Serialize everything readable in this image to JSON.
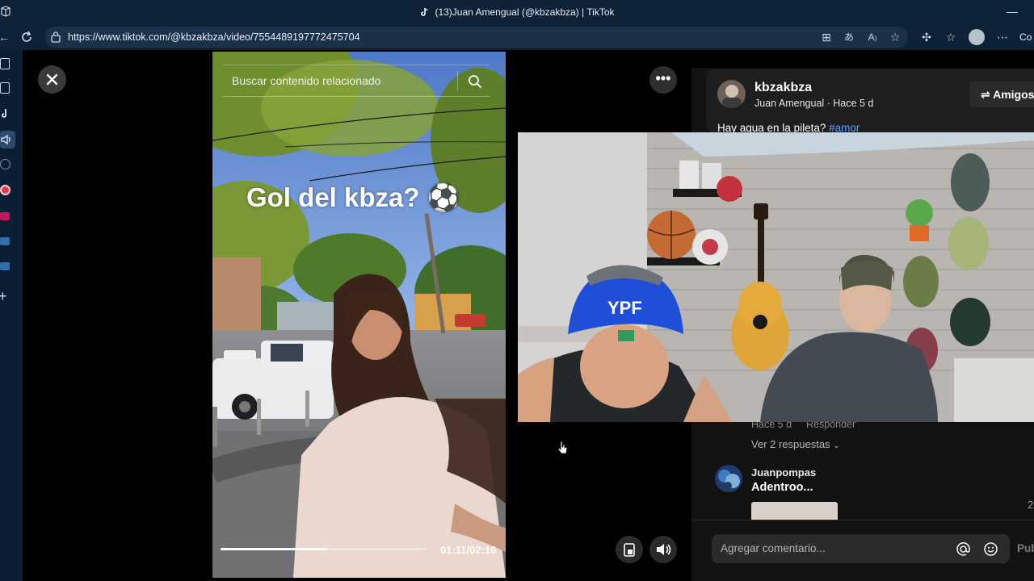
{
  "browser": {
    "tab_title": "(13)Juan Amengual (@kbzakbza) | TikTok",
    "url": "https://www.tiktok.com/@kbzakbza/video/7554489197772475704",
    "profile_letters": "Co"
  },
  "video": {
    "search_placeholder": "Buscar contenido relacionado",
    "caption_overlay": "Gol del kbza? ⚽",
    "time": "01:11/02:16",
    "progress": 0.52
  },
  "post": {
    "username": "kbzakbza",
    "display_name_date": "Juan Amengual · Hace 5 d",
    "follow_button": "⇌ Amigos",
    "description": "Hay agua en la pileta?",
    "hashtag": "#amor"
  },
  "comments": [
    {
      "meta_time": "Hace 5 d",
      "reply": "Responder",
      "view_replies": "Ver 2 respuestas"
    },
    {
      "user": "Juanpompas",
      "text": "Adentroo...",
      "likes": "2"
    }
  ],
  "composer": {
    "placeholder": "Agregar comentario...",
    "post_label": "Pub"
  },
  "colors": {
    "hashtag": "#5b9cff",
    "page_bg": "#000000",
    "chrome_bg": "#0d2236"
  }
}
